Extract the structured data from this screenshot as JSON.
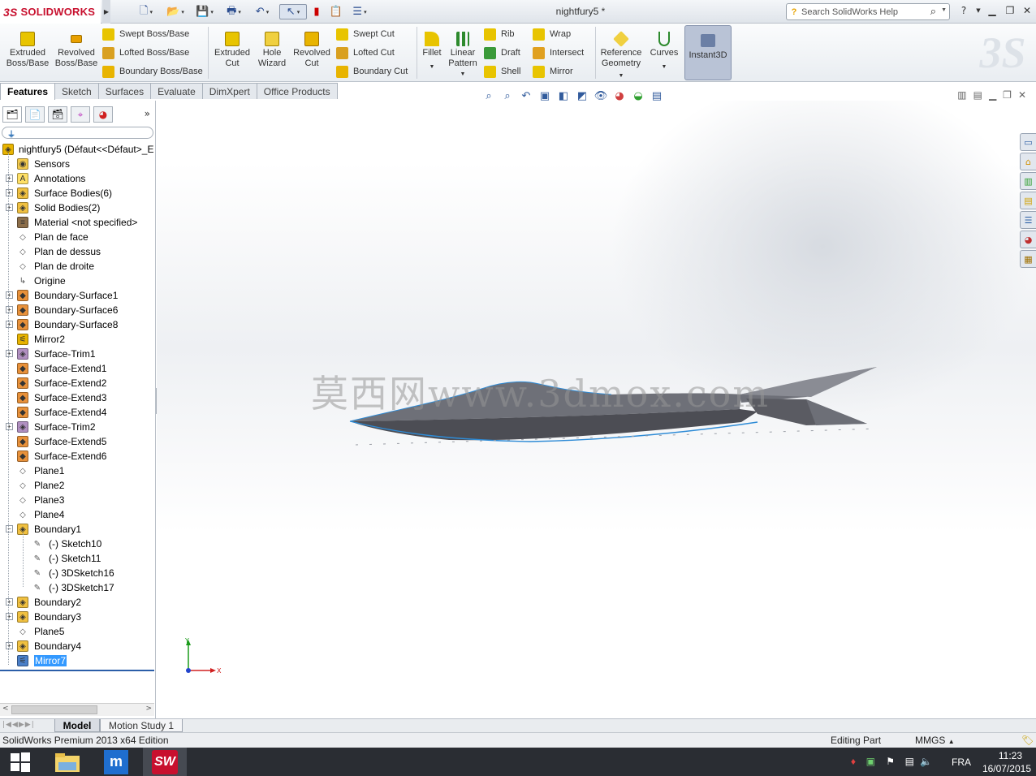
{
  "app": {
    "brand": "SOLIDWORKS",
    "brand_prefix": "3S",
    "document_title": "nightfury5 *"
  },
  "search": {
    "placeholder": "Search SolidWorks Help"
  },
  "commands": {
    "extruded_boss": "Extruded Boss/Base",
    "revolved_boss": "Revolved Boss/Base",
    "swept_boss": "Swept Boss/Base",
    "lofted_boss": "Lofted Boss/Base",
    "boundary_boss": "Boundary Boss/Base",
    "extruded_cut": "Extruded Cut",
    "hole_wizard": "Hole Wizard",
    "revolved_cut": "Revolved Cut",
    "swept_cut": "Swept Cut",
    "lofted_cut": "Lofted Cut",
    "boundary_cut": "Boundary Cut",
    "fillet": "Fillet",
    "linear_pattern": "Linear Pattern",
    "rib": "Rib",
    "draft": "Draft",
    "shell": "Shell",
    "wrap": "Wrap",
    "intersect": "Intersect",
    "mirror": "Mirror",
    "reference_geometry": "Reference Geometry",
    "curves": "Curves",
    "instant3d": "Instant3D"
  },
  "tabs": [
    "Features",
    "Sketch",
    "Surfaces",
    "Evaluate",
    "DimXpert",
    "Office Products"
  ],
  "tree": [
    {
      "label": "nightfury5  (Défaut<<Défaut>_E",
      "level": 0,
      "expand": "",
      "icon": "part-icon",
      "color": "#e8b400"
    },
    {
      "label": "Sensors",
      "level": 1,
      "expand": "",
      "icon": "sensor-icon",
      "color": "#f2c94c"
    },
    {
      "label": "Annotations",
      "level": 1,
      "expand": "+",
      "icon": "annotation-icon",
      "color": "#ffe066"
    },
    {
      "label": "Surface Bodies(6)",
      "level": 1,
      "expand": "+",
      "icon": "surface-bodies-icon",
      "color": "#f0c040"
    },
    {
      "label": "Solid Bodies(2)",
      "level": 1,
      "expand": "+",
      "icon": "solid-bodies-icon",
      "color": "#f0c040"
    },
    {
      "label": "Material <not specified>",
      "level": 1,
      "expand": "",
      "icon": "material-icon",
      "color": "#8c6e4a"
    },
    {
      "label": "Plan de face",
      "level": 1,
      "expand": "",
      "icon": "plane-icon",
      "color": "#ffffff"
    },
    {
      "label": "Plan de dessus",
      "level": 1,
      "expand": "",
      "icon": "plane-icon",
      "color": "#ffffff"
    },
    {
      "label": "Plan de droite",
      "level": 1,
      "expand": "",
      "icon": "plane-icon",
      "color": "#ffffff"
    },
    {
      "label": "Origine",
      "level": 1,
      "expand": "",
      "icon": "origin-icon",
      "color": "#ffffff"
    },
    {
      "label": "Boundary-Surface1",
      "level": 1,
      "expand": "+",
      "icon": "boundary-surface-icon",
      "color": "#e8913a"
    },
    {
      "label": "Boundary-Surface6",
      "level": 1,
      "expand": "+",
      "icon": "boundary-surface-icon",
      "color": "#e8913a"
    },
    {
      "label": "Boundary-Surface8",
      "level": 1,
      "expand": "+",
      "icon": "boundary-surface-icon",
      "color": "#e8913a"
    },
    {
      "label": "Mirror2",
      "level": 1,
      "expand": "",
      "icon": "mirror-icon",
      "color": "#e8b400"
    },
    {
      "label": "Surface-Trim1",
      "level": 1,
      "expand": "+",
      "icon": "surface-trim-icon",
      "color": "#b08fc0"
    },
    {
      "label": "Surface-Extend1",
      "level": 1,
      "expand": "",
      "icon": "surface-extend-icon",
      "color": "#e8913a"
    },
    {
      "label": "Surface-Extend2",
      "level": 1,
      "expand": "",
      "icon": "surface-extend-icon",
      "color": "#e8913a"
    },
    {
      "label": "Surface-Extend3",
      "level": 1,
      "expand": "",
      "icon": "surface-extend-icon",
      "color": "#e8913a"
    },
    {
      "label": "Surface-Extend4",
      "level": 1,
      "expand": "",
      "icon": "surface-extend-icon",
      "color": "#e8913a"
    },
    {
      "label": "Surface-Trim2",
      "level": 1,
      "expand": "+",
      "icon": "surface-trim-icon",
      "color": "#b08fc0"
    },
    {
      "label": "Surface-Extend5",
      "level": 1,
      "expand": "",
      "icon": "surface-extend-icon",
      "color": "#e8913a"
    },
    {
      "label": "Surface-Extend6",
      "level": 1,
      "expand": "",
      "icon": "surface-extend-icon",
      "color": "#e8913a"
    },
    {
      "label": "Plane1",
      "level": 1,
      "expand": "",
      "icon": "plane-icon",
      "color": "#ffffff"
    },
    {
      "label": "Plane2",
      "level": 1,
      "expand": "",
      "icon": "plane-icon",
      "color": "#ffffff"
    },
    {
      "label": "Plane3",
      "level": 1,
      "expand": "",
      "icon": "plane-icon",
      "color": "#ffffff"
    },
    {
      "label": "Plane4",
      "level": 1,
      "expand": "",
      "icon": "plane-icon",
      "color": "#ffffff"
    },
    {
      "label": "Boundary1",
      "level": 1,
      "expand": "-",
      "icon": "boundary-icon",
      "color": "#f0c040"
    },
    {
      "label": "(-) Sketch10",
      "level": 2,
      "expand": "",
      "icon": "sketch-icon",
      "color": "#ffffff"
    },
    {
      "label": "(-) Sketch11",
      "level": 2,
      "expand": "",
      "icon": "sketch-icon",
      "color": "#ffffff"
    },
    {
      "label": "(-) 3DSketch16",
      "level": 2,
      "expand": "",
      "icon": "3dsketch-icon",
      "color": "#ffffff"
    },
    {
      "label": "(-) 3DSketch17",
      "level": 2,
      "expand": "",
      "icon": "3dsketch-icon",
      "color": "#ffffff"
    },
    {
      "label": "Boundary2",
      "level": 1,
      "expand": "+",
      "icon": "boundary-icon",
      "color": "#f0c040"
    },
    {
      "label": "Boundary3",
      "level": 1,
      "expand": "+",
      "icon": "boundary-icon",
      "color": "#f0c040"
    },
    {
      "label": "Plane5",
      "level": 1,
      "expand": "",
      "icon": "plane-icon",
      "color": "#ffffff"
    },
    {
      "label": "Boundary4",
      "level": 1,
      "expand": "+",
      "icon": "boundary-icon",
      "color": "#f0c040"
    },
    {
      "label": "Mirror7",
      "level": 1,
      "expand": "",
      "icon": "mirror-icon",
      "color": "#4a7fc8",
      "selected": true
    }
  ],
  "viewport": {
    "watermark": "莫西网www.3dmox.com",
    "triad_x": "X",
    "triad_y": "Y"
  },
  "bottom_tabs": [
    "Model",
    "Motion Study 1"
  ],
  "status": {
    "edition": "SolidWorks Premium 2013 x64 Edition",
    "mode": "Editing Part",
    "units": "MMGS"
  },
  "taskbar": {
    "lang": "FRA",
    "time": "11:23",
    "date": "16/07/2015"
  },
  "colors": {
    "accent": "#c8102e",
    "selection": "#3399ff",
    "model_edge": "#2e8bd6",
    "model_surface": "#55565d"
  }
}
